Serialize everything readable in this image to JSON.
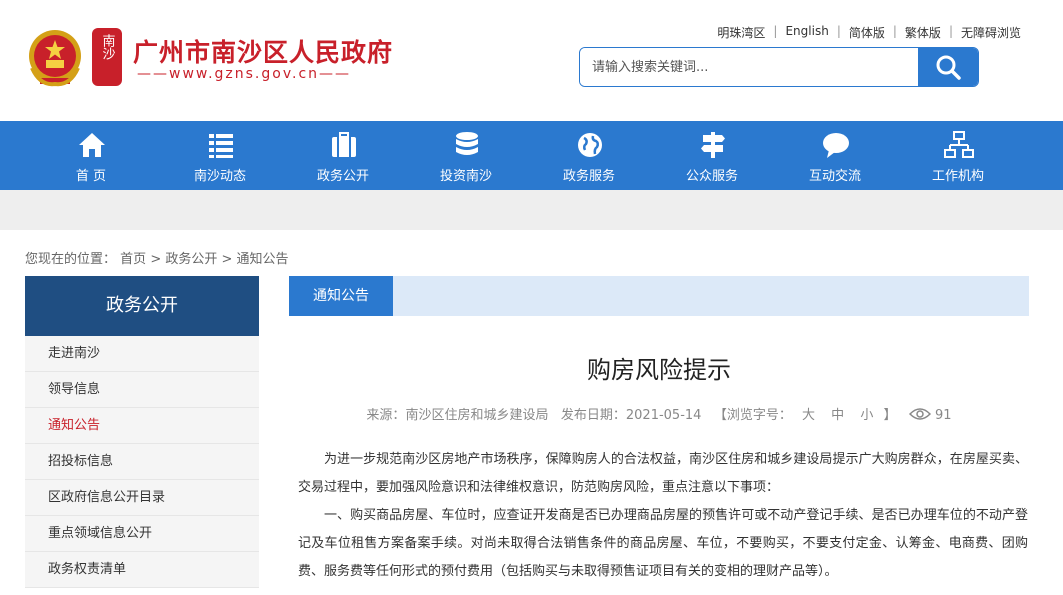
{
  "header": {
    "site_title": "广州市南沙区人民政府",
    "site_url": "——www.gzns.gov.cn——",
    "seal_text": "南沙",
    "toplinks": [
      "明珠湾区",
      "English",
      "简体版",
      "繁体版",
      "无障碍浏览"
    ],
    "search_placeholder": "请输入搜索关键词..."
  },
  "nav": {
    "items": [
      {
        "label": "首 页",
        "icon": "home-icon"
      },
      {
        "label": "南沙动态",
        "icon": "list-icon"
      },
      {
        "label": "政务公开",
        "icon": "briefcase-icon"
      },
      {
        "label": "投资南沙",
        "icon": "database-icon"
      },
      {
        "label": "政务服务",
        "icon": "globe-icon"
      },
      {
        "label": "公众服务",
        "icon": "signpost-icon"
      },
      {
        "label": "互动交流",
        "icon": "chat-icon"
      },
      {
        "label": "工作机构",
        "icon": "org-chart-icon"
      }
    ]
  },
  "breadcrumb": {
    "prefix": "您现在的位置：",
    "items": [
      "首页",
      "政务公开",
      "通知公告"
    ],
    "separator": " > "
  },
  "sidebar": {
    "title": "政务公开",
    "items": [
      "走进南沙",
      "领导信息",
      "通知公告",
      "招投标信息",
      "区政府信息公开目录",
      "重点领域信息公开",
      "政务权责清单"
    ],
    "active_index": 2
  },
  "main": {
    "tab_label": "通知公告",
    "title": "购房风险提示",
    "meta": {
      "source_label": "来源：",
      "source": "南沙区住房和城乡建设局",
      "date_label": "发布日期：",
      "date": "2021-05-14",
      "font_label": "【浏览字号：",
      "font_sizes": [
        "大",
        "中",
        "小"
      ],
      "font_close": "】",
      "views": "91"
    },
    "paragraphs": [
      "为进一步规范南沙区房地产市场秩序，保障购房人的合法权益，南沙区住房和城乡建设局提示广大购房群众，在房屋买卖、交易过程中，要加强风险意识和法律维权意识，防范购房风险，重点注意以下事项：",
      "一、购买商品房屋、车位时，应查证开发商是否已办理商品房屋的预售许可或不动产登记手续、是否已办理车位的不动产登记及车位租售方案备案手续。对尚未取得合法销售条件的商品房屋、车位，不要购买，不要支付定金、认筹金、电商费、团购费、服务费等任何形式的预付费用（包括购买与未取得预售证项目有关的变相的理财产品等）。"
    ]
  },
  "colors": {
    "brand_red": "#c8202a",
    "nav_blue": "#2b79cf",
    "sidebar_head": "#1f4e82",
    "tab_bar_bg": "#dce9f8"
  }
}
